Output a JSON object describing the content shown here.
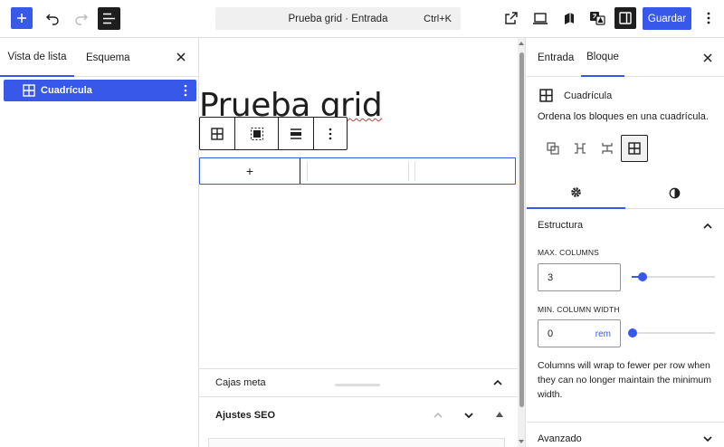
{
  "topbar": {
    "command_title": "Prueba grid · Entrada",
    "command_shortcut": "Ctrl+K",
    "save_label": "Guardar"
  },
  "left_panel": {
    "tabs": [
      "Vista de lista",
      "Esquema"
    ],
    "tree_item": "Cuadrícula"
  },
  "canvas": {
    "post_title_a": "Prueba ",
    "post_title_b": "grid",
    "grid_appender": "+"
  },
  "meta": {
    "cajas_meta": "Cajas meta",
    "ajustes_seo": "Ajustes SEO"
  },
  "sidebar": {
    "tabs": [
      "Entrada",
      "Bloque"
    ],
    "block_title": "Cuadrícula",
    "block_desc": "Ordena los bloques en una cuadrícula.",
    "panel_title": "Estructura",
    "max_columns_label": "MAX. COLUMNS",
    "max_columns_value": "3",
    "min_width_label": "MIN. COLUMN WIDTH",
    "min_width_value": "0",
    "min_width_unit": "rem",
    "help_text": "Columns will wrap to fewer per row when they can no longer maintain the minimum width.",
    "advanced": "Avanzado"
  },
  "colors": {
    "accent": "#3858e9",
    "dark": "#1e1e1e",
    "border": "#e0e0e0"
  }
}
